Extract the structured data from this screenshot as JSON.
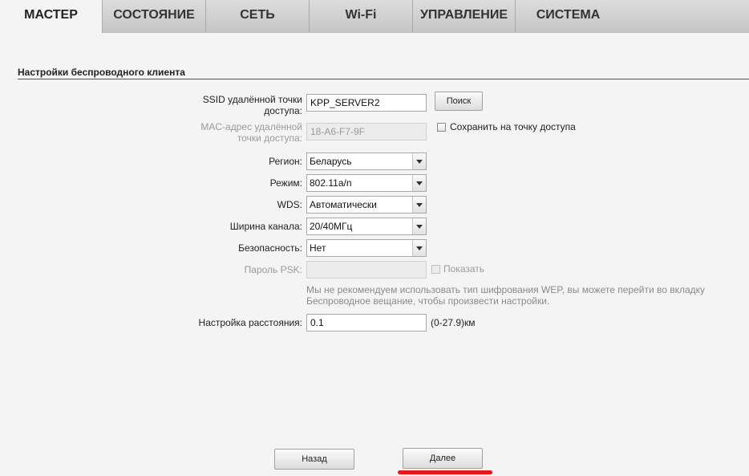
{
  "nav": {
    "tabs": [
      {
        "label": "МАСТЕР",
        "active": true
      },
      {
        "label": "СОСТОЯНИЕ",
        "active": false
      },
      {
        "label": "СЕТЬ",
        "active": false
      },
      {
        "label": "Wi-Fi",
        "active": false
      },
      {
        "label": "УПРАВЛЕНИЕ",
        "active": false
      },
      {
        "label": "СИСТЕМА",
        "active": false
      }
    ]
  },
  "section": {
    "title": "Настройки беспроводного клиента"
  },
  "form": {
    "ssid": {
      "label_line1": "SSID удалённой точки",
      "label_line2": "доступа:",
      "value": "KPP_SERVER2"
    },
    "search_button": "Поиск",
    "mac": {
      "label_line1": "MAC-адрес удалённой",
      "label_line2": "точки доступа:",
      "value": "18-A6-F7-9F"
    },
    "save_to_ap": {
      "label": "Сохранить на точку доступа",
      "checked": false
    },
    "region": {
      "label": "Регион:",
      "value": "Беларусь"
    },
    "mode": {
      "label": "Режим:",
      "value": "802.11a/n"
    },
    "wds": {
      "label": "WDS:",
      "value": "Автоматически"
    },
    "channel_width": {
      "label": "Ширина канала:",
      "value": "20/40МГц"
    },
    "security": {
      "label": "Безопасность:",
      "value": "Нет"
    },
    "psk": {
      "label": "Пароль PSK:",
      "value": ""
    },
    "show_password": {
      "label": "Показать",
      "checked": false
    },
    "note": "Мы не рекомендуем использовать тип шифрования WEP, вы можете перейти во вкладку Беспроводное вещание, чтобы произвести настройки.",
    "distance": {
      "label": "Настройка расстояния:",
      "value": "0.1",
      "unit": "(0-27.9)км"
    }
  },
  "footer": {
    "back_button": "Назад",
    "next_button": "Далее"
  },
  "colors": {
    "highlight": "#e8151b",
    "disabled_text": "#9a9a9a"
  }
}
